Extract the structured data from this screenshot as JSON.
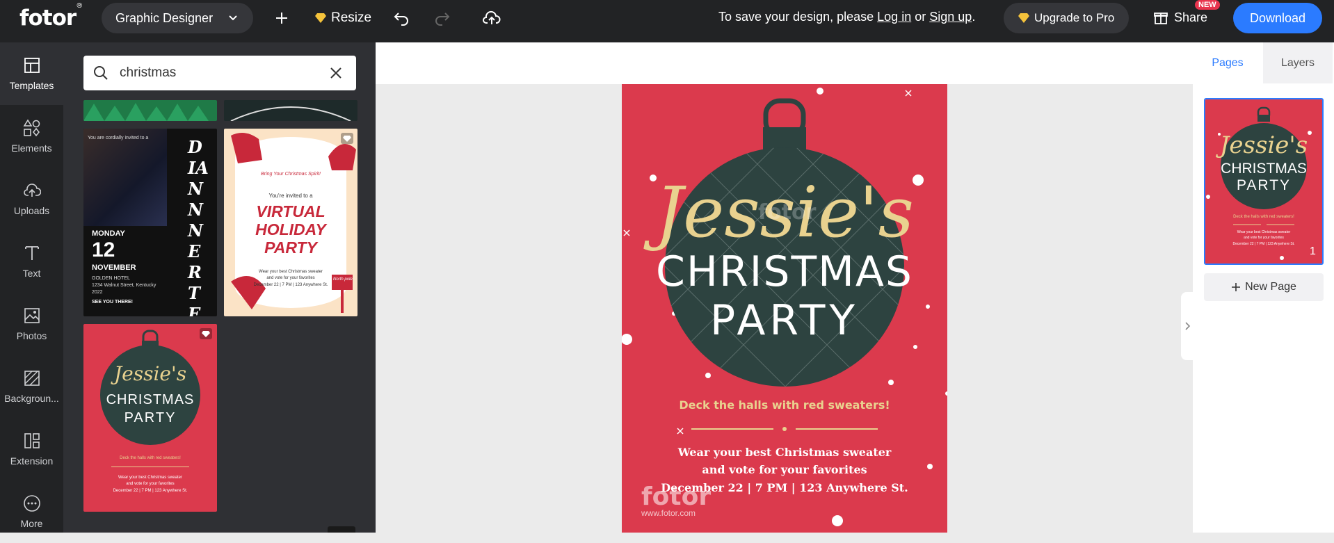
{
  "header": {
    "logo": "fotor",
    "logo_mark": "®",
    "project_type": "Graphic Designer",
    "resize_label": "Resize",
    "save_prefix": "To save your design, please",
    "login_label": "Log in",
    "or_label": "or",
    "signup_label": "Sign up",
    "save_suffix": ".",
    "upgrade_label": "Upgrade to Pro",
    "share_label": "Share",
    "new_badge": "NEW",
    "download_label": "Download"
  },
  "sidebar": {
    "items": [
      {
        "label": "Templates",
        "icon": "templates-icon"
      },
      {
        "label": "Elements",
        "icon": "elements-icon"
      },
      {
        "label": "Uploads",
        "icon": "uploads-icon"
      },
      {
        "label": "Text",
        "icon": "text-icon"
      },
      {
        "label": "Photos",
        "icon": "photos-icon"
      },
      {
        "label": "Backgroun...",
        "icon": "background-icon"
      },
      {
        "label": "Extension",
        "icon": "extension-icon"
      },
      {
        "label": "More",
        "icon": "more-icon"
      }
    ]
  },
  "search": {
    "value": "christmas"
  },
  "templates": {
    "t1": {
      "invite": "You are cordially invited to a",
      "vertical_word": "DIANNNERTER!",
      "day": "MONDAY",
      "date": "12",
      "month": "NOVEMBER",
      "venue": "GOLDEN HOTEL",
      "address": "1234 Walnut Street, Kentucky",
      "year": "2022",
      "cta": "SEE YOU THERE!"
    },
    "t2": {
      "script": "Bring Your Christmas Spirit!",
      "invited": "You're invited to a",
      "line1": "VIRTUAL",
      "line2": "HOLIDAY",
      "line3": "PARTY",
      "detail1": "Wear your best Christmas sweater",
      "detail2": "and vote for your favorites",
      "detail3": "December 22 | 7 PM | 123 Anywhere St.",
      "sign": "North pole"
    },
    "t3": {
      "name": "Jessie's",
      "title1": "CHRISTMAS",
      "title2": "PARTY",
      "tagline": "Deck the halls with red sweaters!",
      "detail1": "Wear your best Christmas sweater",
      "detail2": "and vote for your favorites",
      "detail3": "December 22 | 7 PM | 123 Anywhere St."
    }
  },
  "poster": {
    "name": "Jessie's",
    "title1": "CHRISTMAS",
    "title2": "PARTY",
    "tagline": "Deck the halls with red sweaters!",
    "detail1": "Wear your best Christmas sweater",
    "detail2": "and vote for your favorites",
    "detail3": "December 22 | 7 PM | 123 Anywhere St.",
    "watermark": "fotor",
    "watermark_url": "www.fotor.com",
    "colors": {
      "background": "#db3a4d",
      "ornament": "#2d4340",
      "gold": "#e9d28f"
    }
  },
  "right_panel": {
    "tab_pages": "Pages",
    "tab_layers": "Layers",
    "page_number": "1",
    "new_page_label": "New Page"
  },
  "colors": {
    "accent": "#2b7bff",
    "topbar": "#222325",
    "panel": "#2f3034"
  }
}
